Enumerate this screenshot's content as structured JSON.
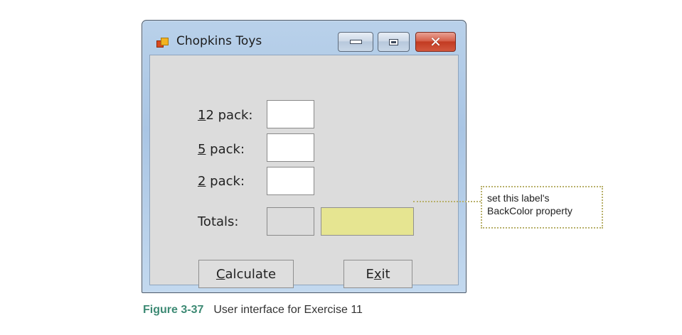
{
  "window": {
    "title": "Chopkins Toys",
    "minimize_icon": "minimize-icon",
    "maximize_icon": "maximize-icon",
    "close_icon": "close-icon",
    "close_glyph": "✕"
  },
  "form": {
    "pack12": {
      "mnemonic": "1",
      "rest": "2 pack:",
      "value": ""
    },
    "pack5": {
      "mnemonic": "5",
      "rest": " pack:",
      "value": ""
    },
    "pack2": {
      "mnemonic": "2",
      "rest": " pack:",
      "value": ""
    },
    "totals_label": "Totals:",
    "totals_value_1": "",
    "totals_value_2": "",
    "totals_label_backcolor": "#e6e591"
  },
  "buttons": {
    "calculate": {
      "mnemonic": "C",
      "rest": "alculate"
    },
    "exit": {
      "pre": "E",
      "mnemonic": "x",
      "post": "it"
    }
  },
  "callout": {
    "line1": "set this label's",
    "line2": "BackColor property"
  },
  "caption": {
    "figure": "Figure 3-37",
    "text": "User interface for Exercise 11"
  }
}
